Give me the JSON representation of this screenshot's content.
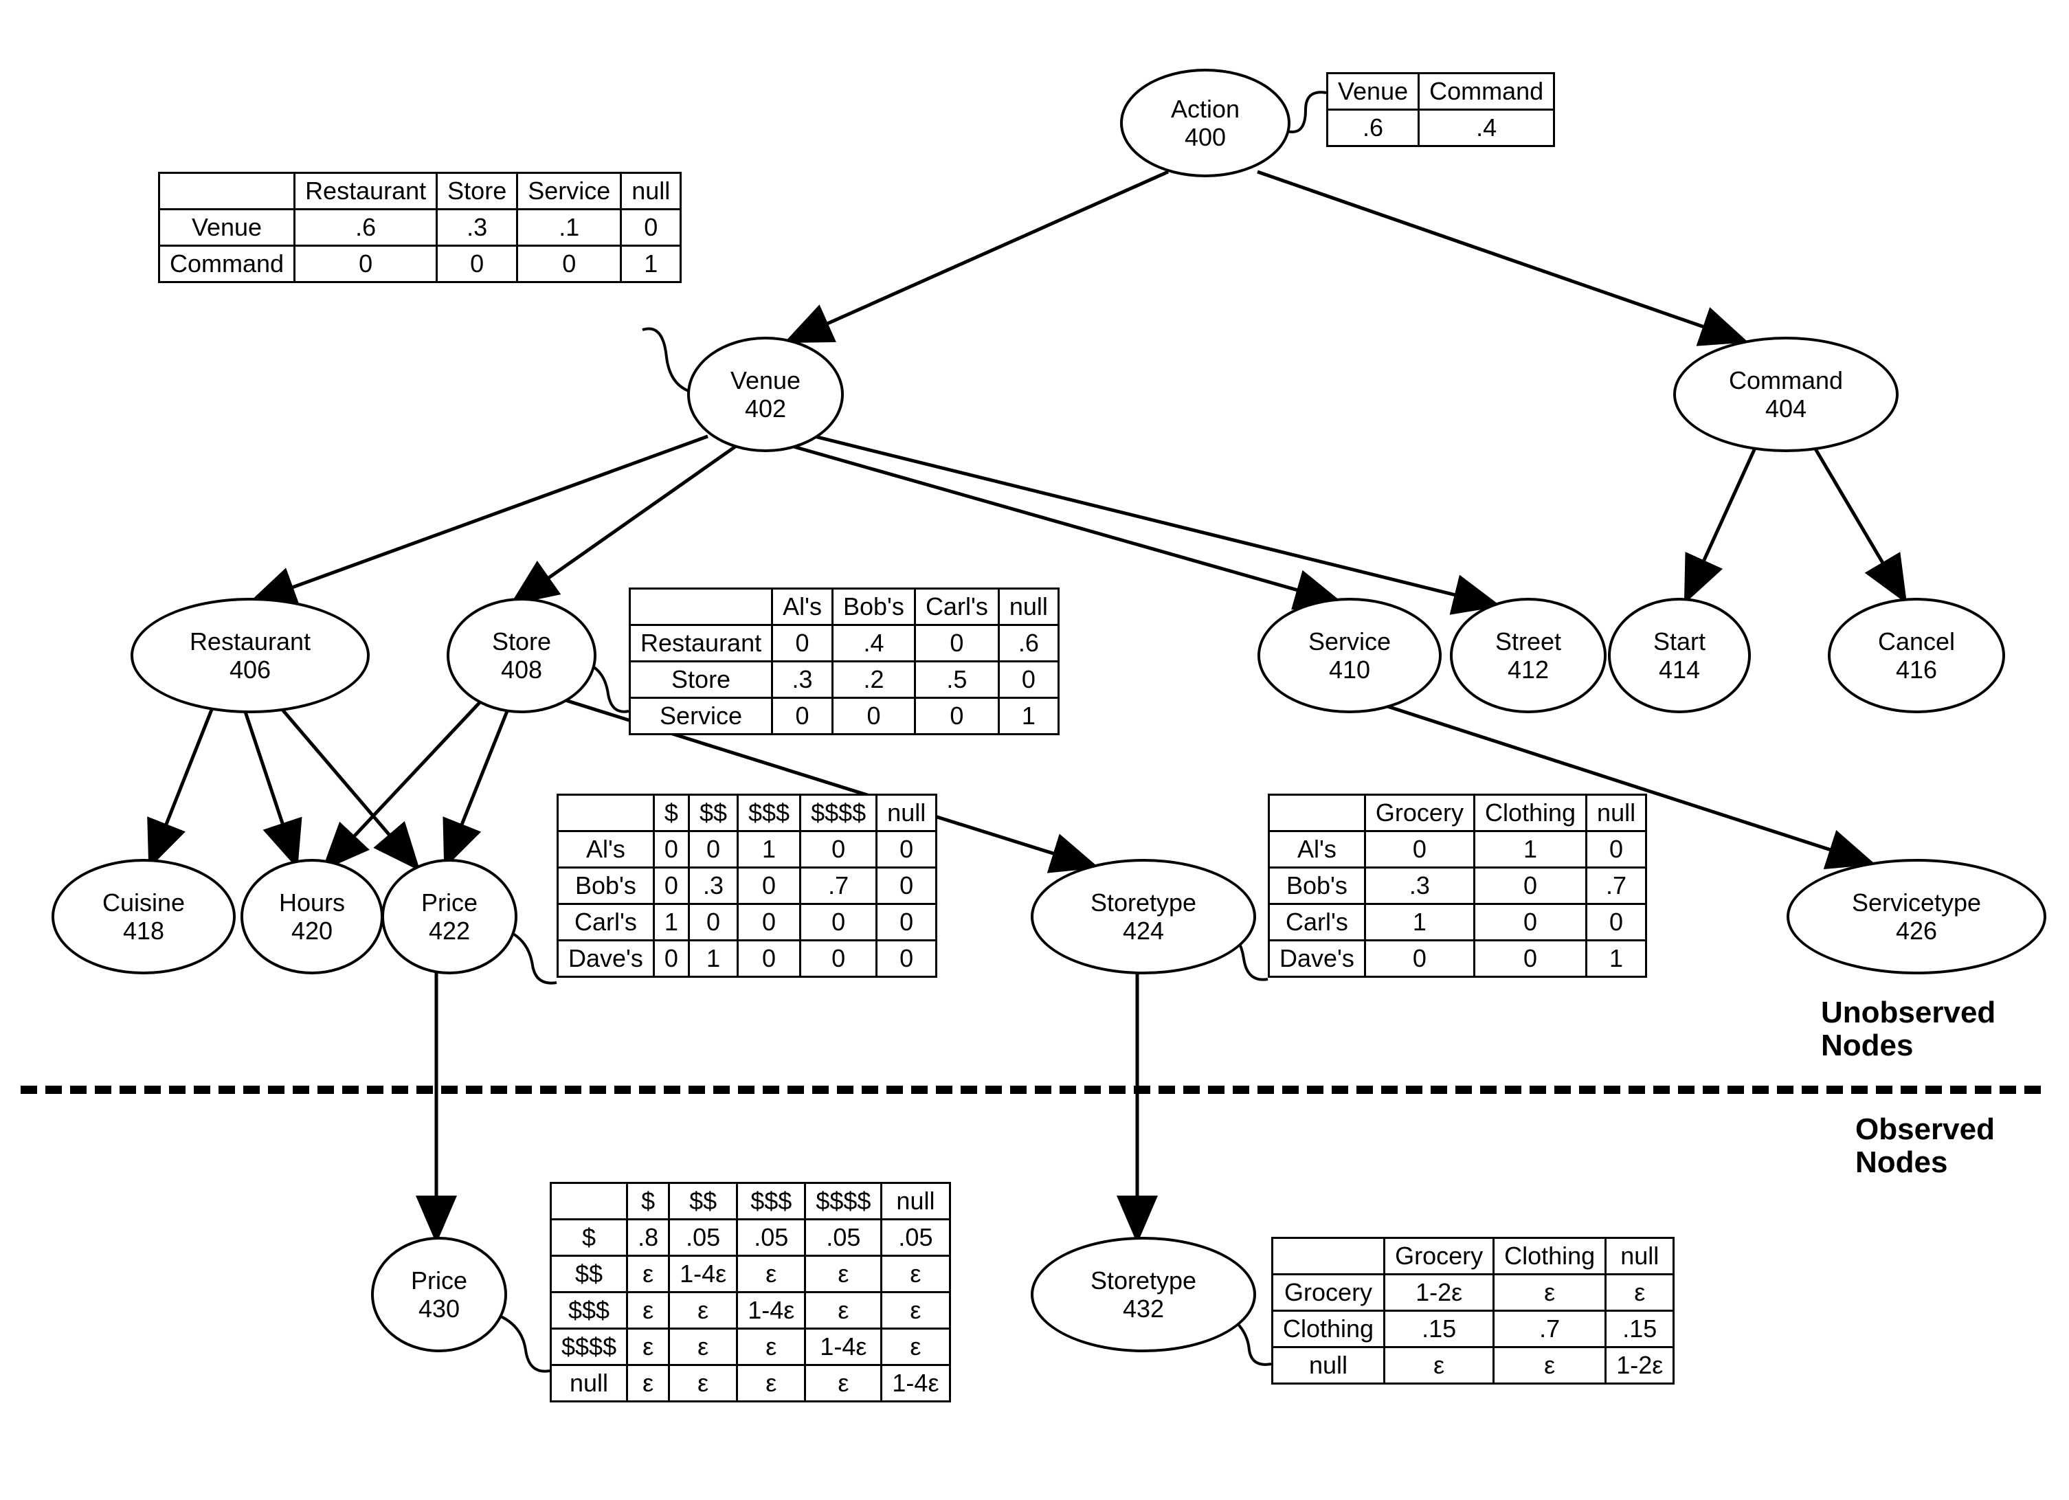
{
  "nodes": {
    "action": {
      "name": "Action",
      "num": "400"
    },
    "venue": {
      "name": "Venue",
      "num": "402"
    },
    "command": {
      "name": "Command",
      "num": "404"
    },
    "restaurant": {
      "name": "Restaurant",
      "num": "406"
    },
    "store": {
      "name": "Store",
      "num": "408"
    },
    "service": {
      "name": "Service",
      "num": "410"
    },
    "street": {
      "name": "Street",
      "num": "412"
    },
    "start": {
      "name": "Start",
      "num": "414"
    },
    "cancel": {
      "name": "Cancel",
      "num": "416"
    },
    "cuisine": {
      "name": "Cuisine",
      "num": "418"
    },
    "hours": {
      "name": "Hours",
      "num": "420"
    },
    "price": {
      "name": "Price",
      "num": "422"
    },
    "storetype": {
      "name": "Storetype",
      "num": "424"
    },
    "servicetype": {
      "name": "Servicetype",
      "num": "426"
    },
    "price_obs": {
      "name": "Price",
      "num": "430"
    },
    "storetype_obs": {
      "name": "Storetype",
      "num": "432"
    }
  },
  "tables": {
    "action": {
      "header": [
        "Venue",
        "Command"
      ],
      "rows": [
        [
          ".6",
          ".4"
        ]
      ]
    },
    "venue": {
      "header": [
        "",
        "Restaurant",
        "Store",
        "Service",
        "null"
      ],
      "rows": [
        [
          "Venue",
          ".6",
          ".3",
          ".1",
          "0"
        ],
        [
          "Command",
          "0",
          "0",
          "0",
          "1"
        ]
      ]
    },
    "store_names": {
      "header": [
        "",
        "Al's",
        "Bob's",
        "Carl's",
        "null"
      ],
      "rows": [
        [
          "Restaurant",
          "0",
          ".4",
          "0",
          ".6"
        ],
        [
          "Store",
          ".3",
          ".2",
          ".5",
          "0"
        ],
        [
          "Service",
          "0",
          "0",
          "0",
          "1"
        ]
      ]
    },
    "price": {
      "header": [
        "",
        "$",
        "$$",
        "$$$",
        "$$$$",
        "null"
      ],
      "rows": [
        [
          "Al's",
          "0",
          "0",
          "1",
          "0",
          "0"
        ],
        [
          "Bob's",
          "0",
          ".3",
          "0",
          ".7",
          "0"
        ],
        [
          "Carl's",
          "1",
          "0",
          "0",
          "0",
          "0"
        ],
        [
          "Dave's",
          "0",
          "1",
          "0",
          "0",
          "0"
        ]
      ]
    },
    "storetype": {
      "header": [
        "",
        "Grocery",
        "Clothing",
        "null"
      ],
      "rows": [
        [
          "Al's",
          "0",
          "1",
          "0"
        ],
        [
          "Bob's",
          ".3",
          "0",
          ".7"
        ],
        [
          "Carl's",
          "1",
          "0",
          "0"
        ],
        [
          "Dave's",
          "0",
          "0",
          "1"
        ]
      ]
    },
    "price_obs": {
      "header": [
        "",
        "$",
        "$$",
        "$$$",
        "$$$$",
        "null"
      ],
      "rows": [
        [
          "$",
          ".8",
          ".05",
          ".05",
          ".05",
          ".05"
        ],
        [
          "$$",
          "ε",
          "1-4ε",
          "ε",
          "ε",
          "ε"
        ],
        [
          "$$$",
          "ε",
          "ε",
          "1-4ε",
          "ε",
          "ε"
        ],
        [
          "$$$$",
          "ε",
          "ε",
          "ε",
          "1-4ε",
          "ε"
        ],
        [
          "null",
          "ε",
          "ε",
          "ε",
          "ε",
          "1-4ε"
        ]
      ]
    },
    "storetype_obs": {
      "header": [
        "",
        "Grocery",
        "Clothing",
        "null"
      ],
      "rows": [
        [
          "Grocery",
          "1-2ε",
          "ε",
          "ε"
        ],
        [
          "Clothing",
          ".15",
          ".7",
          ".15"
        ],
        [
          "null",
          "ε",
          "ε",
          "1-2ε"
        ]
      ]
    }
  },
  "labels": {
    "unobserved": "Unobserved\nNodes",
    "observed": "Observed\nNodes"
  }
}
